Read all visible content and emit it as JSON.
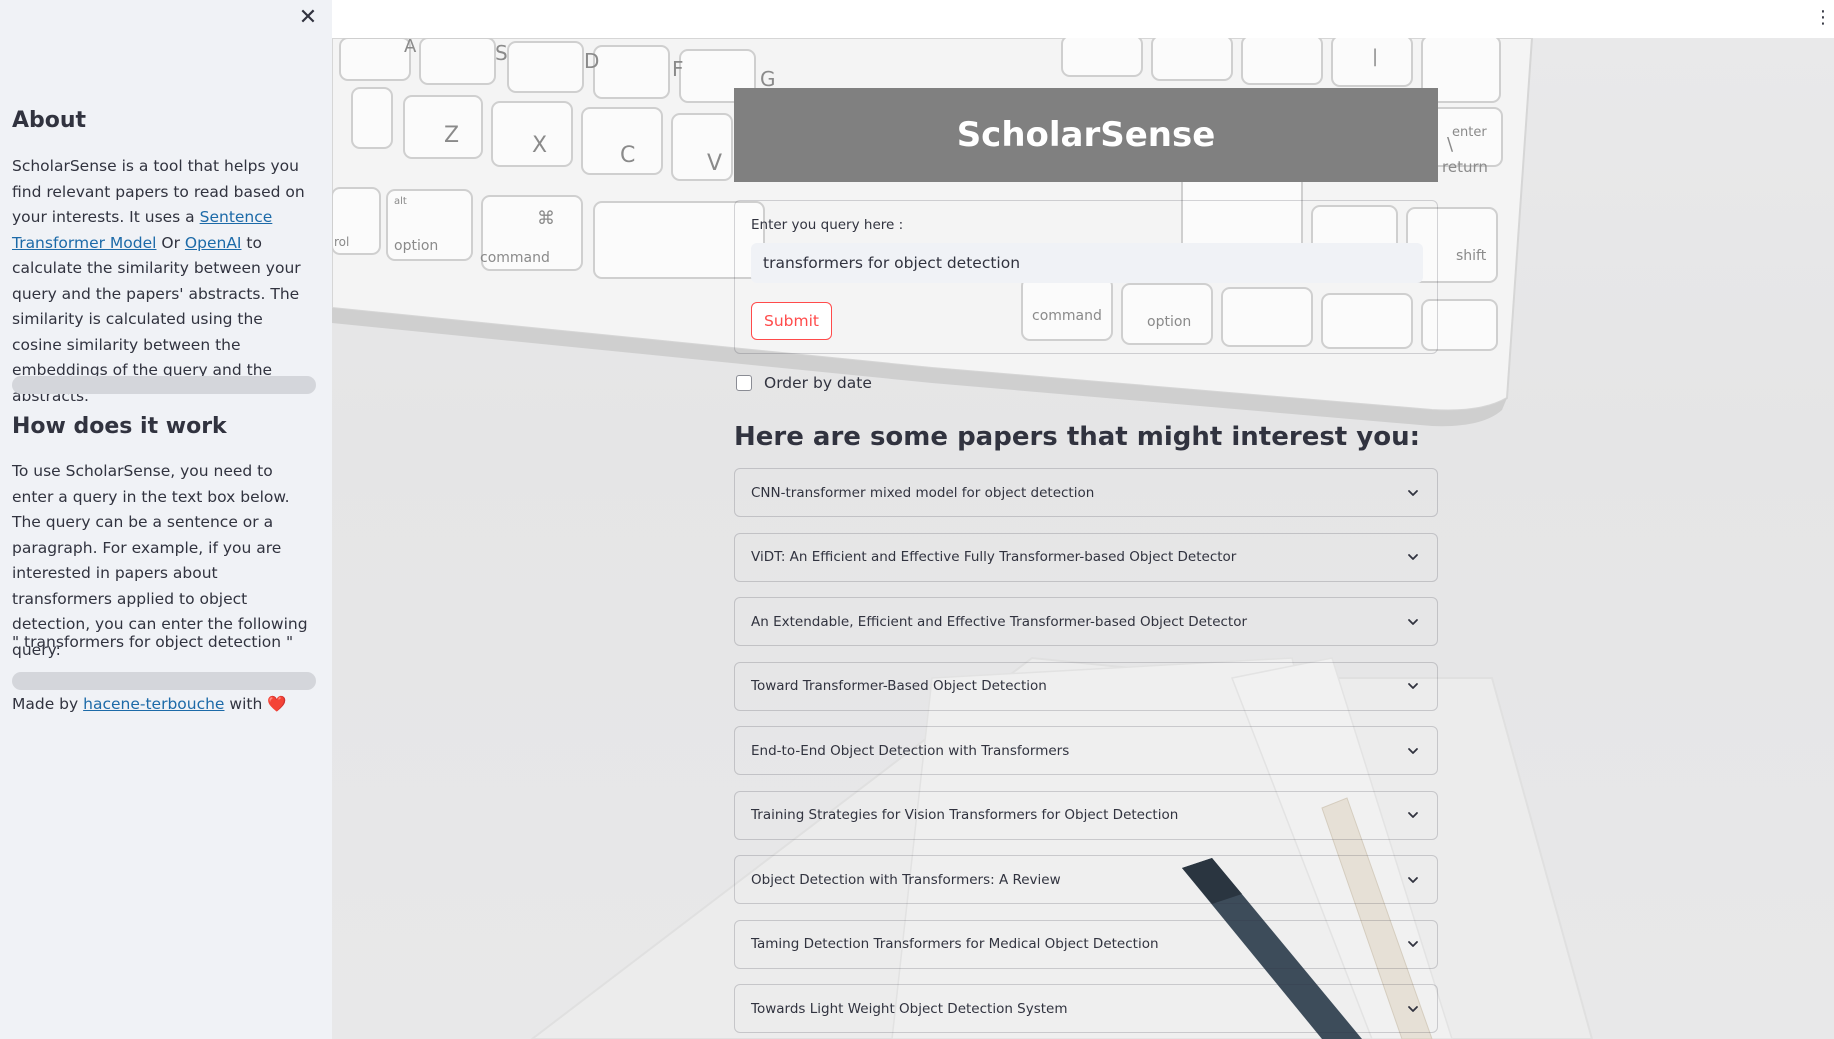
{
  "sidebar": {
    "close_icon": "close-icon",
    "about": {
      "heading": "About",
      "text_1": "ScholarSense is a tool that helps you find relevant papers to read based on your interests. It uses a ",
      "link_1": "Sentence Transformer Model",
      "text_2": " Or ",
      "link_2": "OpenAI",
      "text_3": " to calculate the similarity between your query and the papers' abstracts. The similarity is calculated using the cosine similarity between the embeddings of the query and the abstracts."
    },
    "how": {
      "heading": "How does it work",
      "text": "To use ScholarSense, you need to enter a query in the text box below. The query can be a sentence or a paragraph. For example, if you are interested in papers about transformers applied to object detection, you can enter the following query:",
      "example": "\" transformers for object detection \""
    },
    "made_by": {
      "prefix": "Made by ",
      "author": "hacene-terbouche",
      "suffix": " with ",
      "heart": "❤️"
    }
  },
  "header": {
    "menu_icon": "kebab-menu-icon"
  },
  "main": {
    "title": "ScholarSense",
    "query_label": "Enter you query here :",
    "query_value": "transformers for object detection",
    "submit_label": "Submit",
    "order_label": "Order by date",
    "order_checked": false,
    "results_heading": "Here are some papers that might interest you:",
    "papers": [
      "CNN-transformer mixed model for object detection",
      "ViDT: An Efficient and Effective Fully Transformer-based Object Detector",
      "An Extendable, Efficient and Effective Transformer-based Object Detector",
      "Toward Transformer-Based Object Detection",
      "End-to-End Object Detection with Transformers",
      "Training Strategies for Vision Transformers for Object Detection",
      "Object Detection with Transformers: A Review",
      "Taming Detection Transformers for Medical Object Detection",
      "Towards Light Weight Object Detection System"
    ]
  },
  "colors": {
    "sidebar_bg": "#f0f2f6",
    "title_bg": "#808080",
    "accent": "#ff4b4b",
    "link": "#1c6aa8"
  }
}
